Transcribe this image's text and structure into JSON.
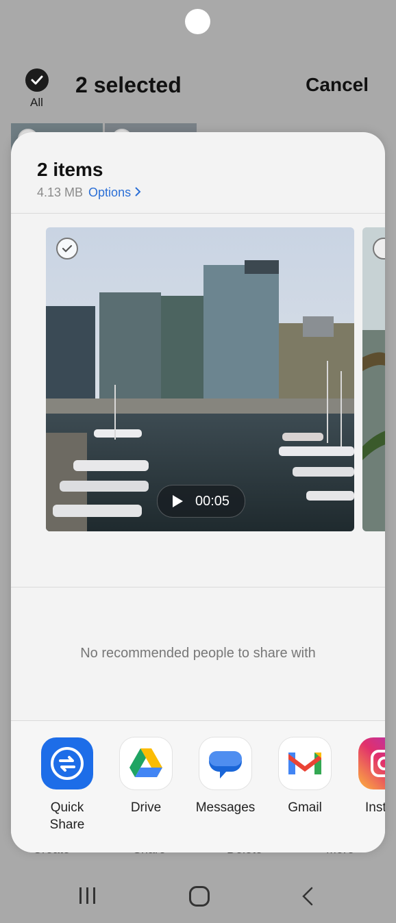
{
  "header": {
    "all_label": "All",
    "title": "2 selected",
    "cancel_label": "Cancel"
  },
  "sheet": {
    "title": "2 items",
    "size": "4.13 MB",
    "options_label": "Options",
    "preview": {
      "duration": "00:05"
    },
    "no_people_text": "No recommended people to share with",
    "apps": [
      {
        "label_line1": "Quick",
        "label_line2": "Share",
        "icon": "quick-share-icon"
      },
      {
        "label_line1": "Drive",
        "label_line2": "",
        "icon": "drive-icon"
      },
      {
        "label_line1": "Messages",
        "label_line2": "",
        "icon": "messages-icon"
      },
      {
        "label_line1": "Gmail",
        "label_line2": "",
        "icon": "gmail-icon"
      },
      {
        "label_line1": "Instag",
        "label_line2": "",
        "icon": "instagram-icon"
      }
    ]
  },
  "bottom_actions": [
    "Create",
    "Share",
    "Delete",
    "More"
  ],
  "colors": {
    "accent": "#2b6fd6",
    "quick_share": "#1d6de8"
  }
}
